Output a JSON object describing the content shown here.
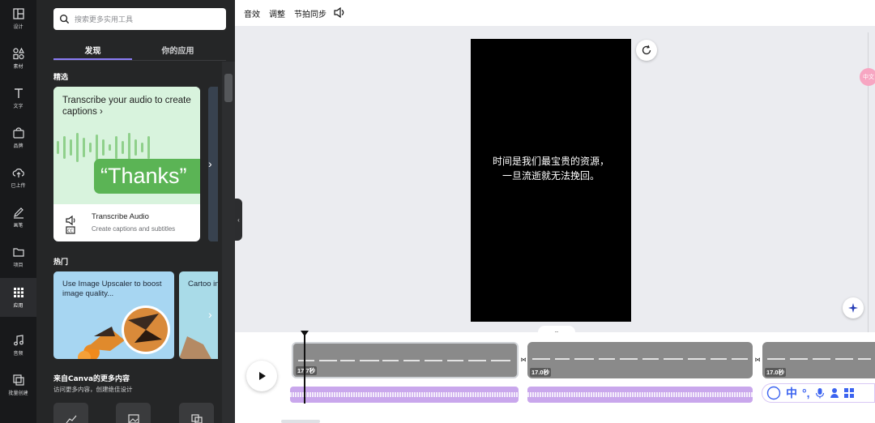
{
  "rail": [
    {
      "label": "设计",
      "icon": "layout-icon"
    },
    {
      "label": "素材",
      "icon": "shapes-icon"
    },
    {
      "label": "文字",
      "icon": "text-icon"
    },
    {
      "label": "品牌",
      "icon": "brand-icon"
    },
    {
      "label": "已上传",
      "icon": "upload-cloud-icon"
    },
    {
      "label": "画笔",
      "icon": "pen-icon"
    },
    {
      "label": "项目",
      "icon": "folder-icon"
    },
    {
      "label": "应用",
      "icon": "apps-grid-icon"
    },
    {
      "label": "音频",
      "icon": "music-note-icon"
    },
    {
      "label": "批量创建",
      "icon": "bulk-create-icon"
    }
  ],
  "panel": {
    "search_placeholder": "搜索更多实用工具",
    "tabs": [
      "发现",
      "你的应用"
    ],
    "section_featured": "精选",
    "featured_card": {
      "title": "Transcribe your audio to create captions ›",
      "badge": "“Thanks”",
      "app_name": "Transcribe Audio",
      "app_desc": "Create captions and subtitles"
    },
    "section_hot": "热门",
    "hot_cards": [
      {
        "title": "Use Image Upscaler to boost image quality..."
      },
      {
        "title": "Cartoo into ca"
      }
    ],
    "more_heading": "来自Canva的更多内容",
    "more_sub": "访问更多内容，创建绝佳设计",
    "carousel_arrow": "›",
    "collapse_arrow": "‹"
  },
  "toolbar": {
    "items": [
      "音效",
      "调整",
      "节拍同步"
    ],
    "volume_icon": "speaker-icon"
  },
  "canvas": {
    "caption_line1": "时间是我们最宝贵的资源，",
    "caption_line2": "一旦流逝就无法挽回。",
    "right_tag": "中文"
  },
  "timeline": {
    "collapse_glyph": "⌄",
    "clips": [
      {
        "time": "17.7秒"
      },
      {
        "time": "17.0秒"
      },
      {
        "time": "17.0秒"
      }
    ],
    "transition_glyph": "⋈",
    "tools": [
      "中",
      "°,"
    ]
  },
  "colors": {
    "accent": "#8b7cf6",
    "audio_track": "#c9a7ec",
    "featured_green": "#5bb455"
  }
}
